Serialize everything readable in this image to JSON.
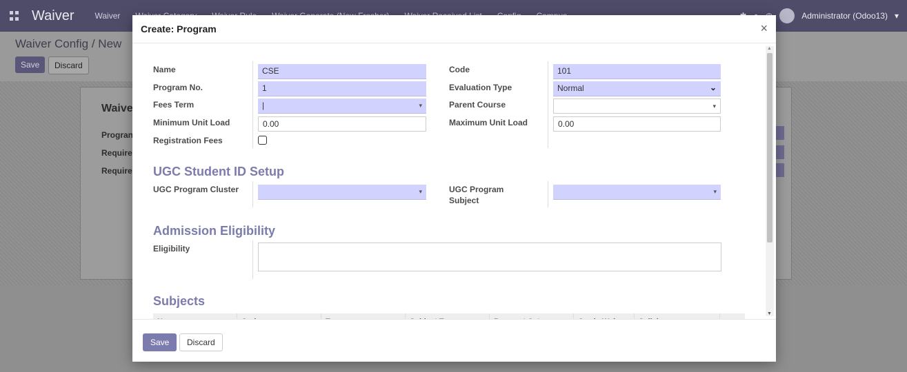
{
  "navbar": {
    "app_title": "Waiver",
    "menu": [
      "Waiver",
      "Waiver Category",
      "Waiver Rule",
      "Waiver Generate (New Fresher)",
      "Waiver Received List",
      "Config",
      "Campus"
    ],
    "user": "Administrator (Odoo13)"
  },
  "background": {
    "breadcrumb": "Waiver Config / New",
    "save_label": "Save",
    "discard_label": "Discard",
    "sheet_title": "Waive",
    "labels": [
      "Progran",
      "Require",
      "Require"
    ]
  },
  "modal": {
    "title": "Create: Program",
    "close": "×",
    "fields": {
      "name": {
        "label": "Name",
        "value": "CSE"
      },
      "code": {
        "label": "Code",
        "value": "101"
      },
      "program_no": {
        "label": "Program No.",
        "value": "1"
      },
      "evaluation_type": {
        "label": "Evaluation Type",
        "value": "Normal"
      },
      "fees_term": {
        "label": "Fees Term",
        "value": "|"
      },
      "parent_course": {
        "label": "Parent Course",
        "value": ""
      },
      "min_unit_load": {
        "label": "Minimum Unit Load",
        "value": "0.00"
      },
      "max_unit_load": {
        "label": "Maximum Unit Load",
        "value": "0.00"
      },
      "registration_fees": {
        "label": "Registration Fees"
      }
    },
    "ugc_section": {
      "title": "UGC Student ID Setup",
      "cluster_label": "UGC Program Cluster",
      "subject_label_1": "UGC Program",
      "subject_label_2": "Subject"
    },
    "admission_section": {
      "title": "Admission Eligibility",
      "eligibility_label": "Eligibility"
    },
    "subjects_section": {
      "title": "Subjects",
      "columns": [
        "Name",
        "Code",
        "Type",
        "Subject Type",
        "Payment Categor",
        "Grade Wei",
        "Syllabuses"
      ]
    },
    "footer": {
      "save_label": "Save",
      "discard_label": "Discard"
    }
  }
}
